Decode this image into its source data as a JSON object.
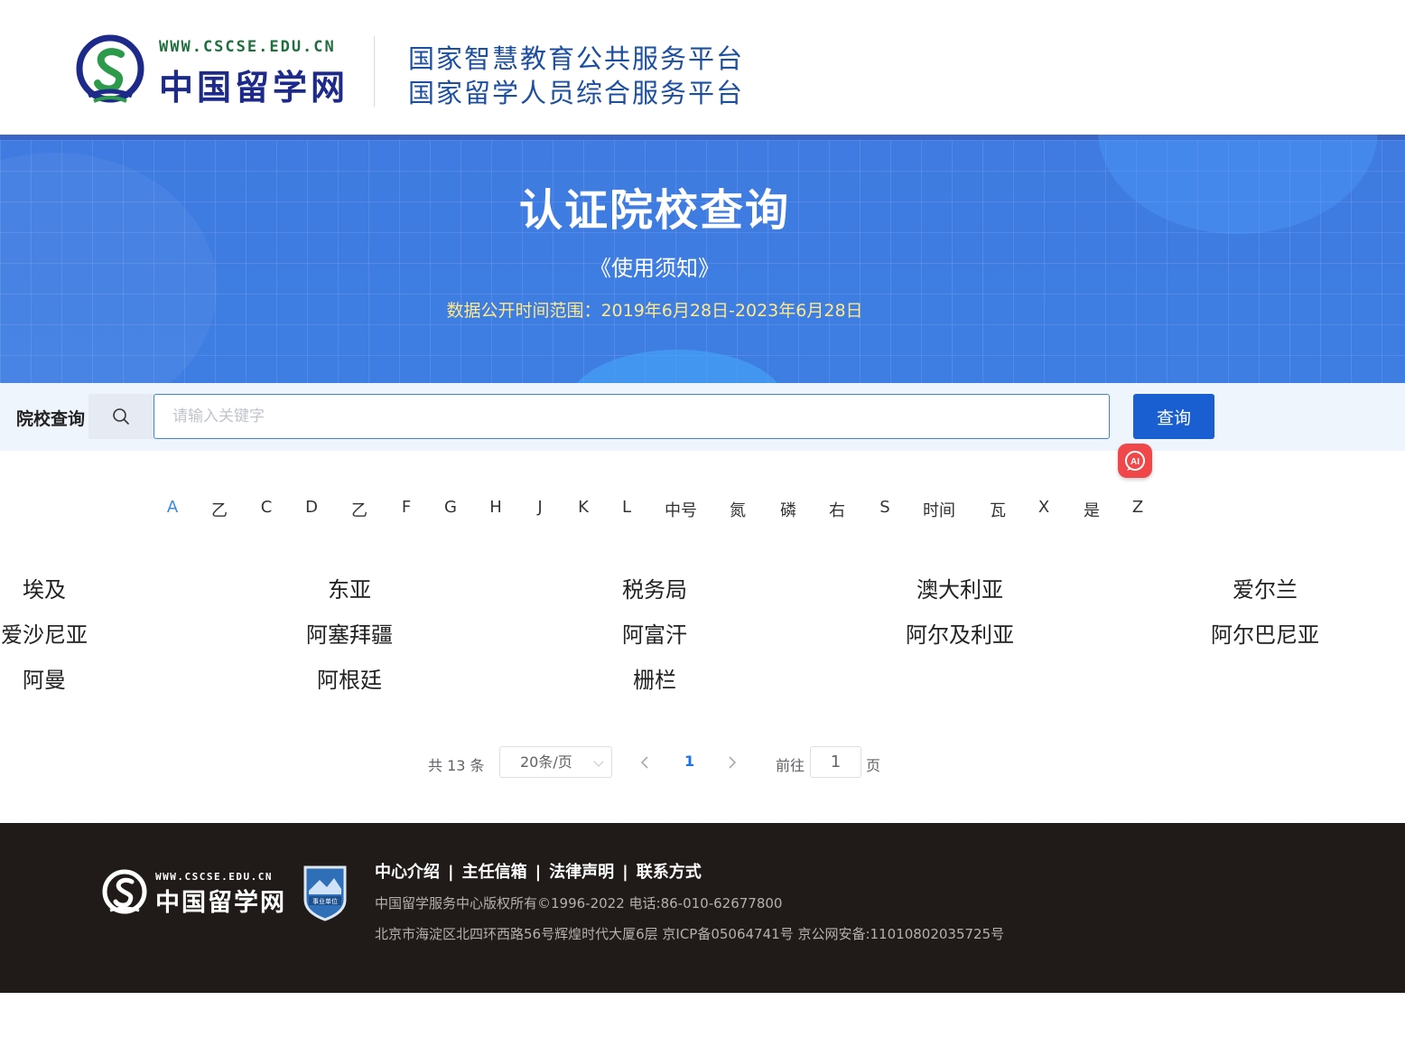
{
  "header": {
    "logo_url": "WWW.CSCSE.EDU.CN",
    "logo_name": "中国留学网",
    "platform_line1": "国家智慧教育公共服务平台",
    "platform_line2": "国家留学人员综合服务平台"
  },
  "banner": {
    "title": "认证院校查询",
    "notice_link": "《使用须知》",
    "date_range": "数据公开时间范围：2019年6月28日-2023年6月28日"
  },
  "search": {
    "label": "院校查询",
    "placeholder": "请输入关键字",
    "value": "",
    "button_label": "查询",
    "ai_badge": "AI"
  },
  "letters": {
    "active_index": 0,
    "items": [
      "A",
      "乙",
      "C",
      "D",
      "乙",
      "F",
      "G",
      "H",
      "J",
      "K",
      "L",
      "中号",
      "氮",
      "磷",
      "右",
      "S",
      "时间",
      "瓦",
      "X",
      "是",
      "Z"
    ]
  },
  "results": [
    [
      "埃及",
      "东亚",
      "税务局",
      "澳大利亚",
      "爱尔兰"
    ],
    [
      "爱沙尼亚",
      "阿塞拜疆",
      "阿富汗",
      "阿尔及利亚",
      "阿尔巴尼亚"
    ],
    [
      "阿曼",
      "阿根廷",
      "栅栏"
    ]
  ],
  "pagination": {
    "total_label": "共 13 条",
    "page_size": "20条/页",
    "current_page": "1",
    "goto_label": "前往",
    "goto_value": "1",
    "page_suffix": "页"
  },
  "footer": {
    "logo_url": "WWW.CSCSE.EDU.CN",
    "logo_name": "中国留学网",
    "badge_text": "事业单位",
    "links": [
      "中心介绍",
      "主任信箱",
      "法律声明",
      "联系方式"
    ],
    "copyright": "中国留学服务中心版权所有©1996-2022 电话:86-010-62677800",
    "address": "北京市海淀区北四环西路56号辉煌时代大厦6层 京ICP备05064741号 京公网安备:11010802035725号"
  },
  "colors": {
    "brand_blue": "#1a5fd1",
    "banner_blue": "#3e7ee3",
    "active_letter": "#3a87e8",
    "footer_bg": "#201b19",
    "date_range_text": "#ffe98a"
  }
}
